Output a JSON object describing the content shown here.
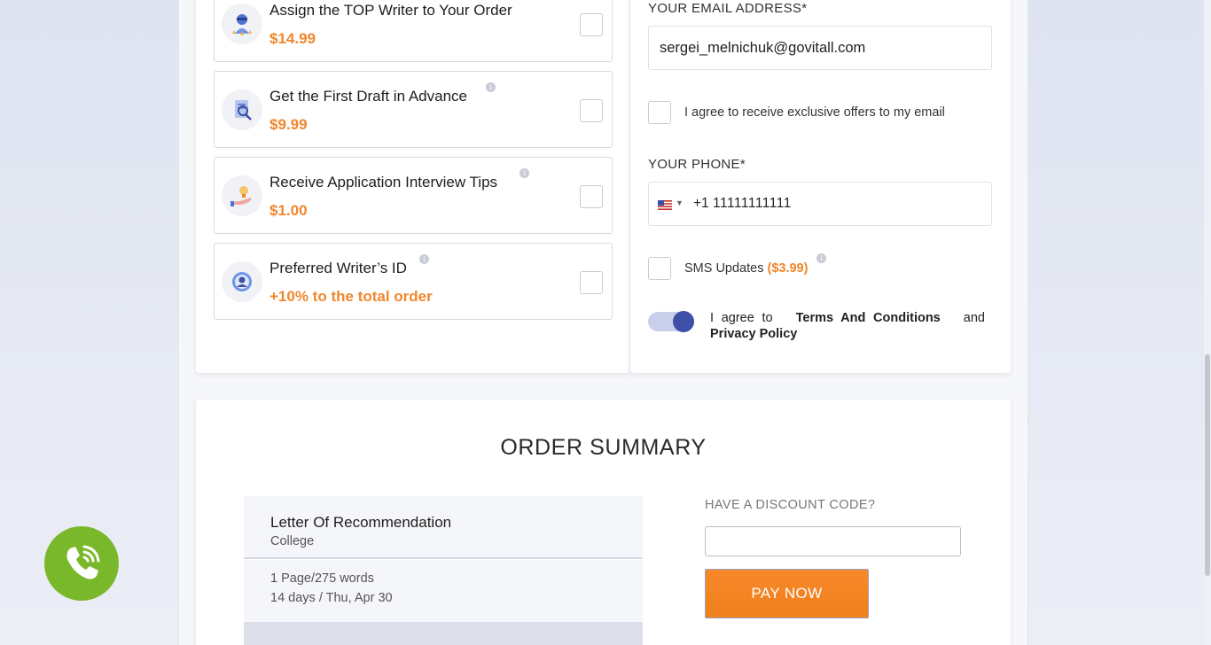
{
  "extras": [
    {
      "name": "Assign the TOP Writer to Your Order",
      "price": "$14.99",
      "icon": "writer-badge-icon"
    },
    {
      "name": "Get the First Draft in Advance",
      "price": "$9.99",
      "icon": "draft-document-icon"
    },
    {
      "name": "Receive Application Interview Tips",
      "price": "$1.00",
      "icon": "lightbulb-hand-icon"
    },
    {
      "name": "Preferred Writer’s ID",
      "price": "+10% to the total order",
      "icon": "writer-id-icon"
    }
  ],
  "contact": {
    "email_label": "YOUR EMAIL ADDRESS*",
    "email_value": "sergei_melnichuk@govitall.com",
    "offers_label": "I agree to receive exclusive offers to my email",
    "phone_label": "YOUR PHONE*",
    "phone_code": "+1",
    "phone_value": "11111111111",
    "sms_label": "SMS Updates",
    "sms_price": "($3.99)",
    "agree_prefix": "I agree to",
    "terms_link": "Terms And Conditions",
    "agree_and": "and",
    "privacy_link": "Privacy Policy"
  },
  "summary": {
    "title": "ORDER SUMMARY",
    "paper_type": "Letter Of Recommendation",
    "level": "College",
    "pages": "1 Page/275 words",
    "deadline": "14 days / Thu, Apr 30",
    "discount_label": "HAVE A DISCOUNT CODE?",
    "discount_value": "",
    "pay_label": "PAY NOW"
  },
  "colors": {
    "accent": "#f2862b",
    "toggle": "#3d4fa6",
    "call": "#7ab82b"
  }
}
